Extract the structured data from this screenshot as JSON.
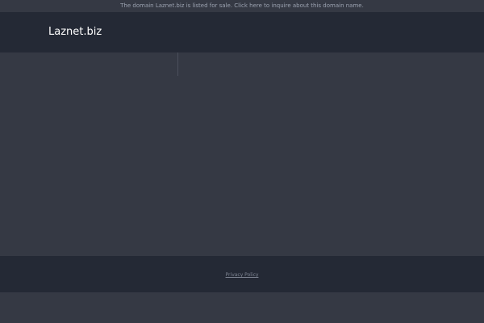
{
  "banner": {
    "text": "The domain Laznet.biz is listed for sale. Click here to inquire about this domain name."
  },
  "header": {
    "site_title": "Laznet.biz"
  },
  "footer": {
    "privacy_label": "Privacy Policy"
  },
  "colors": {
    "background": "#353944",
    "header_footer": "#242935",
    "banner_text": "#9ba2b0",
    "title_text": "#ffffff",
    "link_text": "#7d8391"
  }
}
